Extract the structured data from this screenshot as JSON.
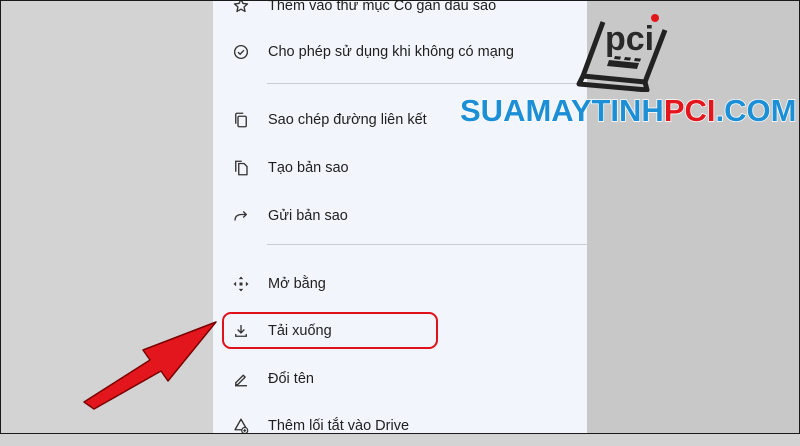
{
  "menu": {
    "items": [
      {
        "label": "Thêm vào thư mục Có gắn dấu sao",
        "icon": "star-icon"
      },
      {
        "label": "Cho phép sử dụng khi không có mạng",
        "icon": "offline-check-icon"
      },
      {
        "label": "Sao chép đường liên kết",
        "icon": "copy-link-icon"
      },
      {
        "label": "Tạo bản sao",
        "icon": "make-copy-icon"
      },
      {
        "label": "Gửi bản sao",
        "icon": "share-arrow-icon"
      },
      {
        "label": "Mở bằng",
        "icon": "open-with-icon"
      },
      {
        "label": "Tải xuống",
        "icon": "download-icon"
      },
      {
        "label": "Đổi tên",
        "icon": "rename-pencil-icon"
      },
      {
        "label": "Thêm lối tắt vào Drive",
        "icon": "add-shortcut-icon"
      }
    ]
  },
  "annotation": {
    "highlight_color": "#e0111b",
    "highlighted_item": "Tải xuống"
  },
  "watermark": {
    "logo_text": "pci",
    "brand_part1": "SUAMAYTINH",
    "brand_part2": "PCI",
    "brand_part3": ".COM",
    "colors": {
      "blue": "#1c8fd6",
      "red": "#e3161d"
    }
  }
}
